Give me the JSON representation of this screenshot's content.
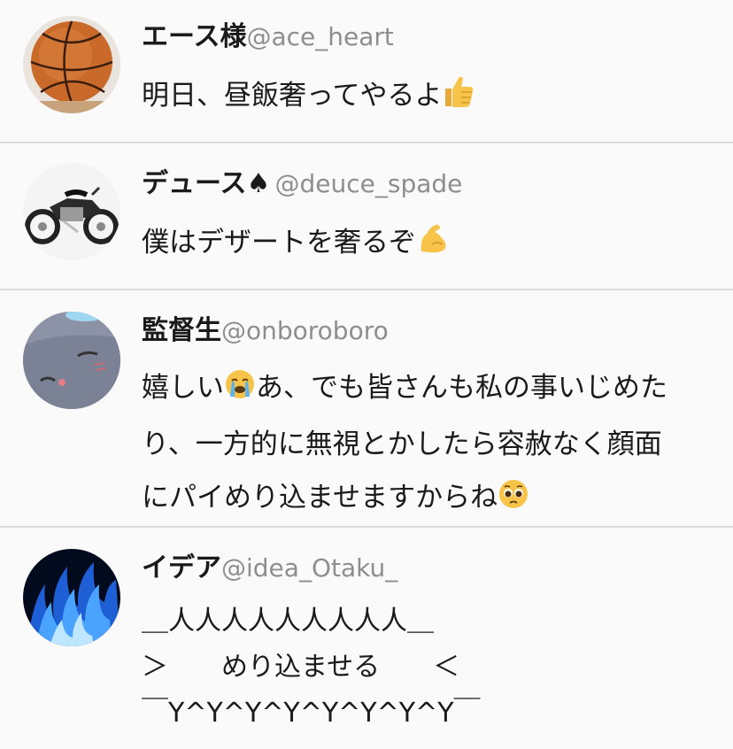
{
  "posts": [
    {
      "name": "エース様",
      "handle": "@ace_heart",
      "text": "明日、昼飯奢ってやるよ",
      "emoji_icon": "thumbs-up-icon",
      "avatar_icon": "basketball-avatar"
    },
    {
      "name": "デュース♠",
      "handle": "@deuce_spade",
      "text": "僕はデザートを奢るぞ",
      "emoji_icon": "flexed-biceps-icon",
      "avatar_icon": "motorcycle-avatar"
    },
    {
      "name": "監督生",
      "handle": "@onboroboro",
      "text_line1_a": "嬉しい",
      "text_line1_b": "あ、でも皆さんも私の事いじめた",
      "text_line2": "り、一方的に無視とかしたら容赦なく顔面",
      "text_line3": "にパイめり込ませますからね",
      "emoji_icon_1": "loudly-crying-face-icon",
      "emoji_icon_2": "pleading-face-icon",
      "avatar_icon": "grim-cat-avatar"
    },
    {
      "name": "イデア",
      "handle": "@idea_Otaku_",
      "text_line1": "＿人人人人人人人人人＿",
      "text_line2": "＞　　めり込ませる　　＜",
      "text_line3": "￣Y^Y^Y^Y^Y^Y^Y^Y￣",
      "avatar_icon": "blue-flame-avatar"
    }
  ],
  "colors": {
    "background": "#fafafa",
    "divider": "#dcdcdc",
    "handle_gray": "#8e8e8e",
    "text": "#1a1a1a"
  }
}
